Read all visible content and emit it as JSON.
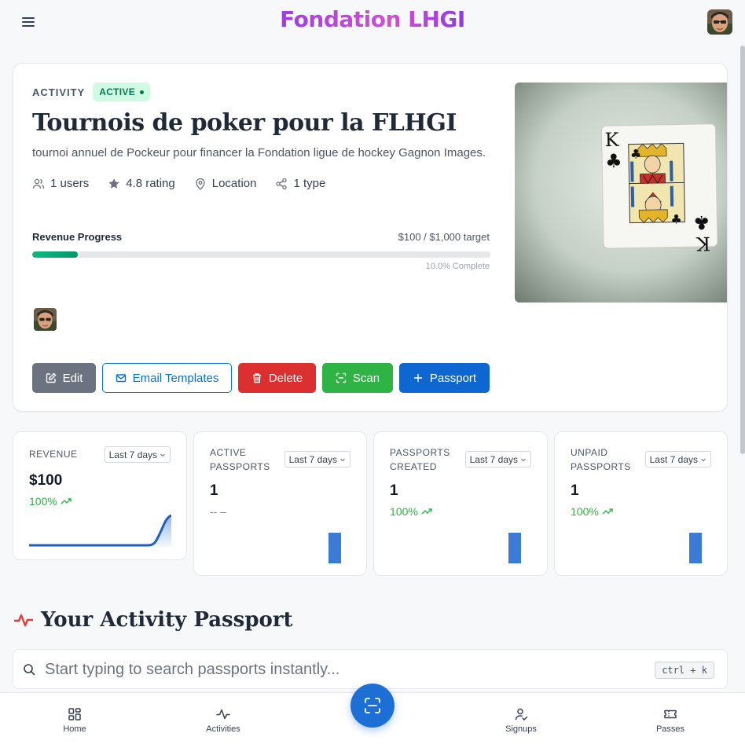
{
  "header": {
    "brand": "Fondation LHGI",
    "menu_icon": "hamburger-menu-icon",
    "avatar": "user-avatar"
  },
  "activity": {
    "section_label": "ACTIVITY",
    "status": "ACTIVE",
    "title": "Tournois de poker pour la FLHGI",
    "description": "tournoi annuel de Pockeur pour financer la Fondation ligue de hockey Gagnon Images.",
    "users": "1 users",
    "rating": "4.8 rating",
    "location": "Location",
    "types": "1 type",
    "image_alt": "King of clubs playing card"
  },
  "revenue_progress": {
    "label": "Revenue Progress",
    "target_text": "$100 / $1,000 target",
    "complete_text": "10.0% Complete",
    "fraction": 0.1
  },
  "actions": {
    "edit": "Edit",
    "email_templates": "Email Templates",
    "delete": "Delete",
    "scan": "Scan",
    "passport": "Passport"
  },
  "stats": [
    {
      "label": "REVENUE",
      "period": "Last 7 days",
      "value": "$100",
      "trend": "100%"
    },
    {
      "label": "ACTIVE PASSPORTS",
      "period": "Last 7 days",
      "value": "1",
      "trend": "-- –"
    },
    {
      "label": "PASSPORTS CREATED",
      "period": "Last 7 days",
      "value": "1",
      "trend": "100%"
    },
    {
      "label": "UNPAID PASSPORTS",
      "period": "Last 7 days",
      "value": "1",
      "trend": "100%"
    }
  ],
  "passport_section": {
    "title": "Your Activity Passport",
    "search_placeholder": "Start typing to search passports instantly...",
    "shortcut": "ctrl + k"
  },
  "bottom_nav": {
    "home": "Home",
    "activities": "Activities",
    "signups": "Signups",
    "passes": "Passes",
    "scan_icon": "scan-qr-icon"
  },
  "colors": {
    "accent": "#0e66d0",
    "success": "#2fb344",
    "danger": "#dc2f2f",
    "brand_gradient_start": "#a23be6",
    "brand_gradient_end": "#d34fd0"
  }
}
